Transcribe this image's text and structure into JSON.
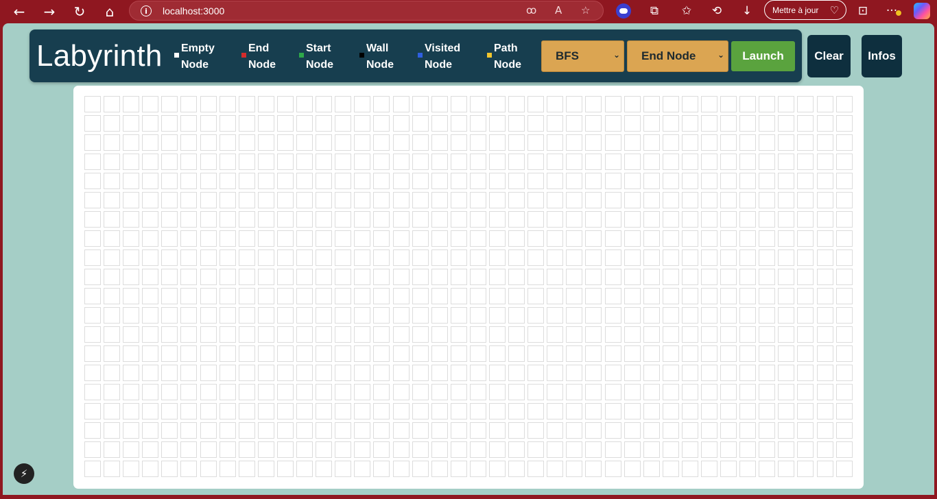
{
  "browser": {
    "url": "localhost:3000",
    "update_label": "Mettre à jour",
    "icons": {
      "back": "←",
      "forward": "→",
      "reload": "↻",
      "home": "⌂",
      "translate": "ꝏ",
      "read_aloud": "A",
      "favorite": "☆",
      "extensions": "⧉",
      "favorites_bar": "✩",
      "history": "⟲",
      "download": "↓",
      "screenshot": "⊡",
      "more": "···",
      "heart": "♡"
    }
  },
  "header": {
    "title": "Labyrinth",
    "legend": [
      {
        "line1": "Empty",
        "line2": "Node",
        "color": "#ffffff"
      },
      {
        "line1": "End",
        "line2": "Node",
        "color": "#d42c2c"
      },
      {
        "line1": "Start",
        "line2": "Node",
        "color": "#2ea84a"
      },
      {
        "line1": "Wall",
        "line2": "Node",
        "color": "#000000"
      },
      {
        "line1": "Visited",
        "line2": "Node",
        "color": "#2f5fe0"
      },
      {
        "line1": "Path",
        "line2": "Node",
        "color": "#f2c62e"
      }
    ],
    "algorithm_select": "BFS",
    "node_select": "End Node",
    "launch_label": "Launch",
    "clear_label": "Clear",
    "infos_label": "Infos"
  },
  "grid": {
    "rows": 20,
    "cols": 40
  },
  "colors": {
    "browser_bar": "#8f1720",
    "page_bg": "#a5cec6",
    "header_bg": "#173e4f",
    "select_bg": "#dba552",
    "launch_bg": "#5aa33e",
    "side_btn_bg": "#0e2f3e"
  },
  "dev_badge_icon": "⚡"
}
